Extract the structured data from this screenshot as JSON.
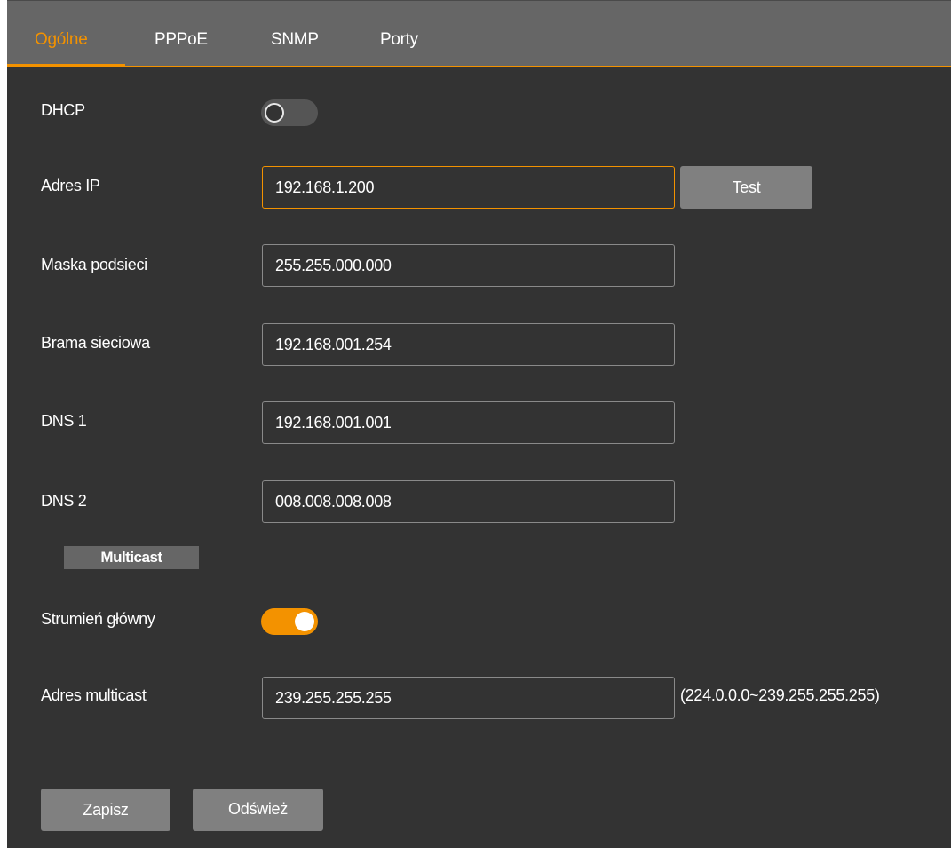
{
  "tabs": [
    {
      "label": "Ogólne",
      "active": true
    },
    {
      "label": "PPPoE",
      "active": false
    },
    {
      "label": "SNMP",
      "active": false
    },
    {
      "label": "Porty",
      "active": false
    }
  ],
  "dhcp": {
    "label": "DHCP",
    "enabled": false
  },
  "ip_address": {
    "label": "Adres IP",
    "value": "192.168.1.200",
    "test_label": "Test"
  },
  "subnet_mask": {
    "label": "Maska podsieci",
    "value": "255.255.000.000"
  },
  "gateway": {
    "label": "Brama sieciowa",
    "value": "192.168.001.254"
  },
  "dns1": {
    "label": "DNS 1",
    "value": "192.168.001.001"
  },
  "dns2": {
    "label": "DNS 2",
    "value": "008.008.008.008"
  },
  "multicast": {
    "section_title": "Multicast",
    "main_stream": {
      "label": "Strumień główny",
      "enabled": true
    },
    "address": {
      "label": "Adres multicast",
      "value": "239.255.255.255",
      "range_hint": "(224.0.0.0~239.255.255.255)"
    }
  },
  "actions": {
    "save_label": "Zapisz",
    "refresh_label": "Odśwież"
  },
  "colors": {
    "accent": "#f39200",
    "panel": "#333333",
    "tabbar": "#666666",
    "button": "#808080"
  }
}
